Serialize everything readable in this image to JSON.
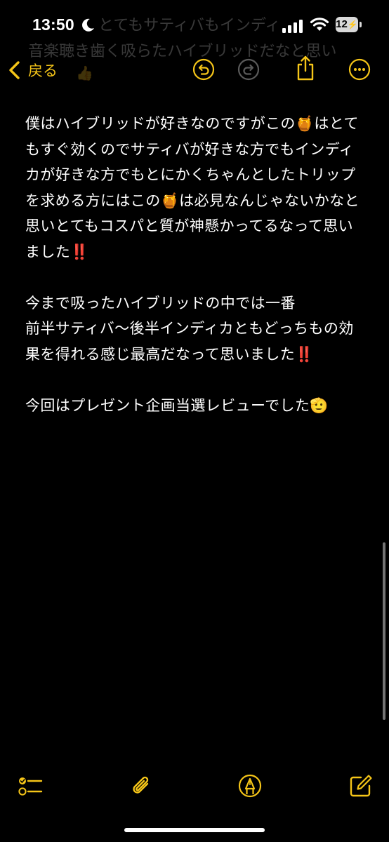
{
  "status_bar": {
    "time": "13:50",
    "battery_level": "12",
    "battery_charging": "⚡"
  },
  "background_text": {
    "line1": "とてもサティバもインディ",
    "line2": "音楽聴き歯く吸らたハイブリッドだなと思い",
    "emoji": "👍"
  },
  "nav": {
    "back_label": "戻る"
  },
  "note": {
    "paragraphs": [
      "僕はハイブリッドが好きなのですがこの🍯はとてもすぐ効くのでサティバが好きな方でもインディカが好きな方でもとにかくちゃんとしたトリップを求める方にはこの🍯は必見なんじゃないかなと思いとてもコスパと質が神懸かってるなって思いました‼️",
      "今まで吸ったハイブリッドの中では一番\n前半サティバ〜後半インディカともどっちもの効果を得れる感じ最高だなって思いました‼️",
      "今回はプレゼント企画当選レビューでした🫡"
    ]
  },
  "colors": {
    "accent": "#f5c518",
    "background": "#000000",
    "text": "#ffffff"
  },
  "icons": {
    "back": "chevron-left-icon",
    "undo": "undo-icon",
    "redo": "redo-icon",
    "share": "share-icon",
    "more": "ellipsis-icon",
    "checklist": "checklist-icon",
    "attachment": "paperclip-icon",
    "markup": "pen-tip-icon",
    "compose": "compose-icon"
  }
}
